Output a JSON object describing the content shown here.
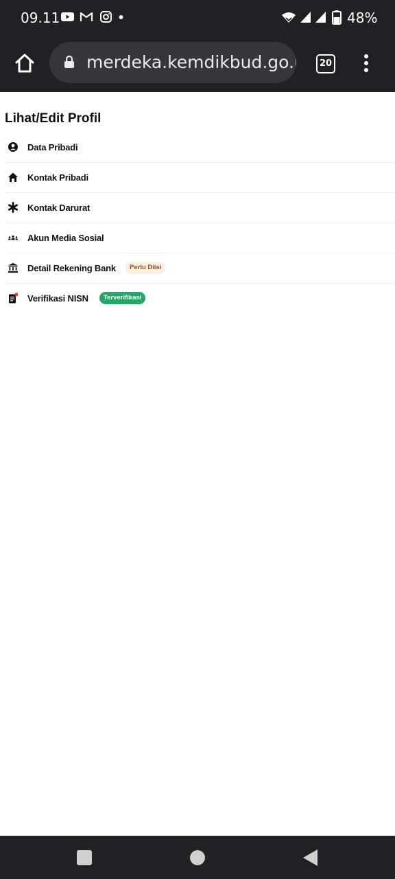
{
  "status_bar": {
    "time": "09.11",
    "battery_percent": "48%",
    "notification_icons": [
      "youtube-icon",
      "gmail-icon",
      "instagram-icon",
      "dot-icon"
    ],
    "system_icons": [
      "wifi-icon",
      "signal-icon",
      "signal-icon",
      "battery-icon"
    ]
  },
  "browser": {
    "url": "merdeka.kemdikbud.go.id",
    "tab_count": "20"
  },
  "page": {
    "title": "Lihat/Edit Profil",
    "items": [
      {
        "label": "Data Pribadi",
        "icon": "account-circle-icon"
      },
      {
        "label": "Kontak Pribadi",
        "icon": "home-icon"
      },
      {
        "label": "Kontak Darurat",
        "icon": "asterisk-icon"
      },
      {
        "label": "Akun Media Sosial",
        "icon": "groups-icon"
      },
      {
        "label": "Detail Rekening Bank",
        "icon": "bank-icon",
        "badge": "Perlu Diisi"
      },
      {
        "label": "Verifikasi NISN",
        "icon": "document-alert-icon",
        "badge": "Terverifikasi"
      }
    ]
  },
  "colors": {
    "bar_background": "#202124",
    "omnibox_background": "#35363a",
    "badge_warning_bg": "#fdeee2",
    "badge_warning_text": "#9a4a1e",
    "badge_success_bg": "#27a567"
  }
}
